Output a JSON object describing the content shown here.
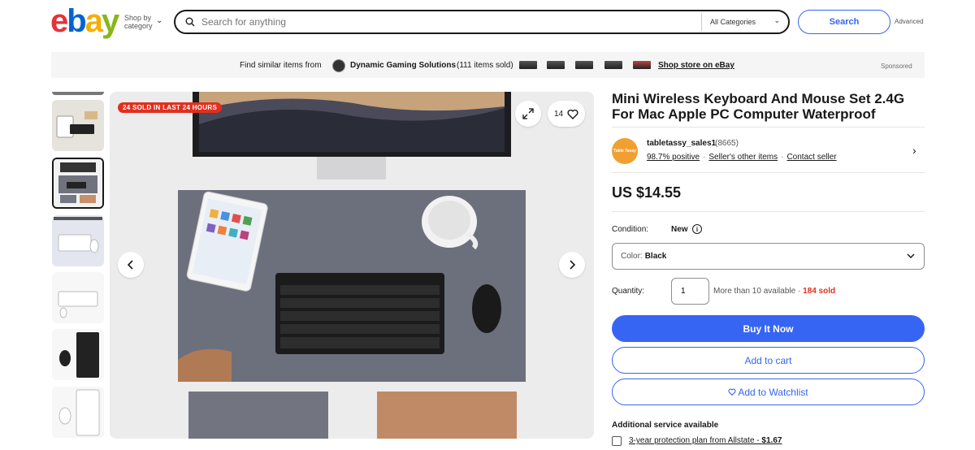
{
  "header": {
    "logo_letters": [
      "e",
      "b",
      "a",
      "y"
    ],
    "shop_by": "Shop by category",
    "search_placeholder": "Search for anything",
    "category": "All Categories",
    "search_button": "Search",
    "advanced": "Advanced"
  },
  "store_bar": {
    "find_similar": "Find similar items from",
    "store_name": "Dynamic Gaming Solutions",
    "items_sold": "(111 items sold)",
    "shop_store": "Shop store on eBay",
    "sponsored": "Sponsored"
  },
  "gallery": {
    "sold_badge": "24 SOLD IN LAST 24 HOURS",
    "watch_count": "14",
    "thumbnail_count": 6,
    "selected_thumbnail": 2
  },
  "listing": {
    "title": "Mini Wireless Keyboard And Mouse Set 2.4G For Mac Apple PC Computer Waterproof",
    "seller": {
      "avatar_text": "Table Tassy",
      "name": "tabletassy_sales1",
      "feedback_count": "(8665)",
      "positive": "98.7% positive",
      "other_items": "Seller's other items",
      "contact": "Contact seller"
    },
    "price": "US $14.55",
    "condition_label": "Condition:",
    "condition_value": "New",
    "color_label": "Color:",
    "color_value": "Black",
    "quantity_label": "Quantity:",
    "quantity_value": "1",
    "available_text": "More than 10 available · ",
    "sold_text": "184 sold",
    "buy_now": "Buy It Now",
    "add_to_cart": "Add to cart",
    "add_to_watchlist": "Add to Watchlist",
    "additional_service": "Additional service available",
    "protection_plan": "3-year protection plan from Allstate - ",
    "protection_price": "$1.67"
  },
  "colors": {
    "accent": "#3665f3",
    "sold_red": "#e0301e"
  }
}
